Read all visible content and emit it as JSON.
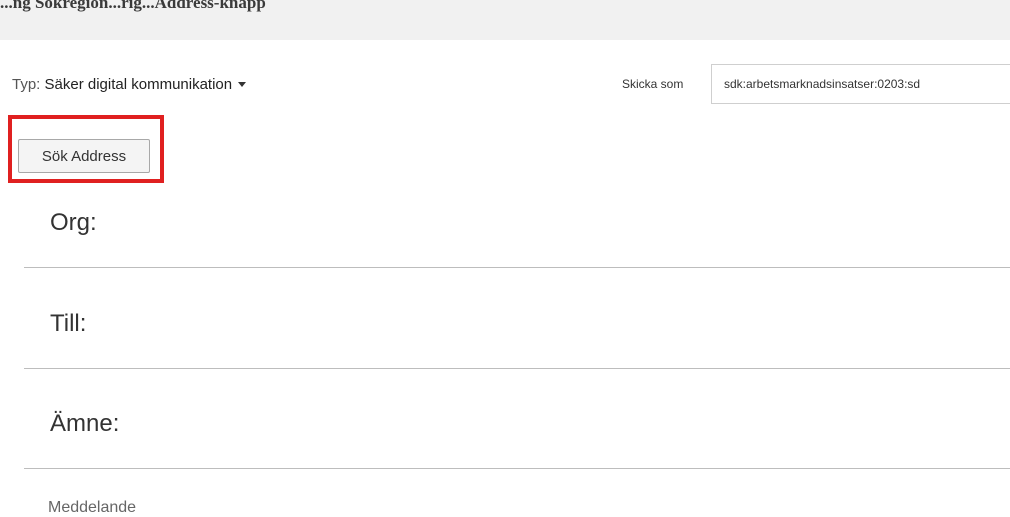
{
  "top_strip": {
    "text": "...ng Sokregion...rig...Address-knapp"
  },
  "type_selector": {
    "prefix": "Typ:",
    "value": "Säker digital kommunikation"
  },
  "send_as": {
    "label": "Skicka som",
    "value": "sdk:arbetsmarknadsinsatser:0203:sd"
  },
  "search_button": {
    "label": "Sök Address"
  },
  "fields": {
    "org": "Org:",
    "till": "Till:",
    "amne": "Ämne:",
    "message": "Meddelande"
  },
  "colors": {
    "highlight": "#e02020",
    "divider": "#bdbdbd"
  }
}
